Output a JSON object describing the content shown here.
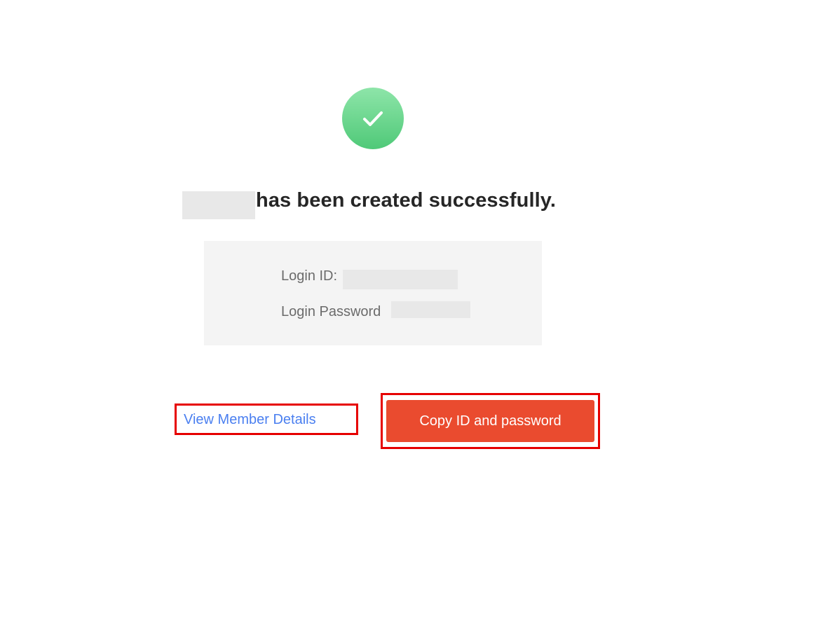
{
  "status": {
    "icon": "checkmark-circle-icon",
    "color": "#52c97a",
    "message": "has been created successfully."
  },
  "credentials": {
    "login_id_label": "Login ID:",
    "login_password_label": "Login Password"
  },
  "actions": {
    "view_details_label": "View Member Details",
    "copy_label": "Copy ID and password",
    "copy_button_color": "#ea4b2f",
    "link_color": "#4a7ff0",
    "highlight_color": "#e60000"
  }
}
